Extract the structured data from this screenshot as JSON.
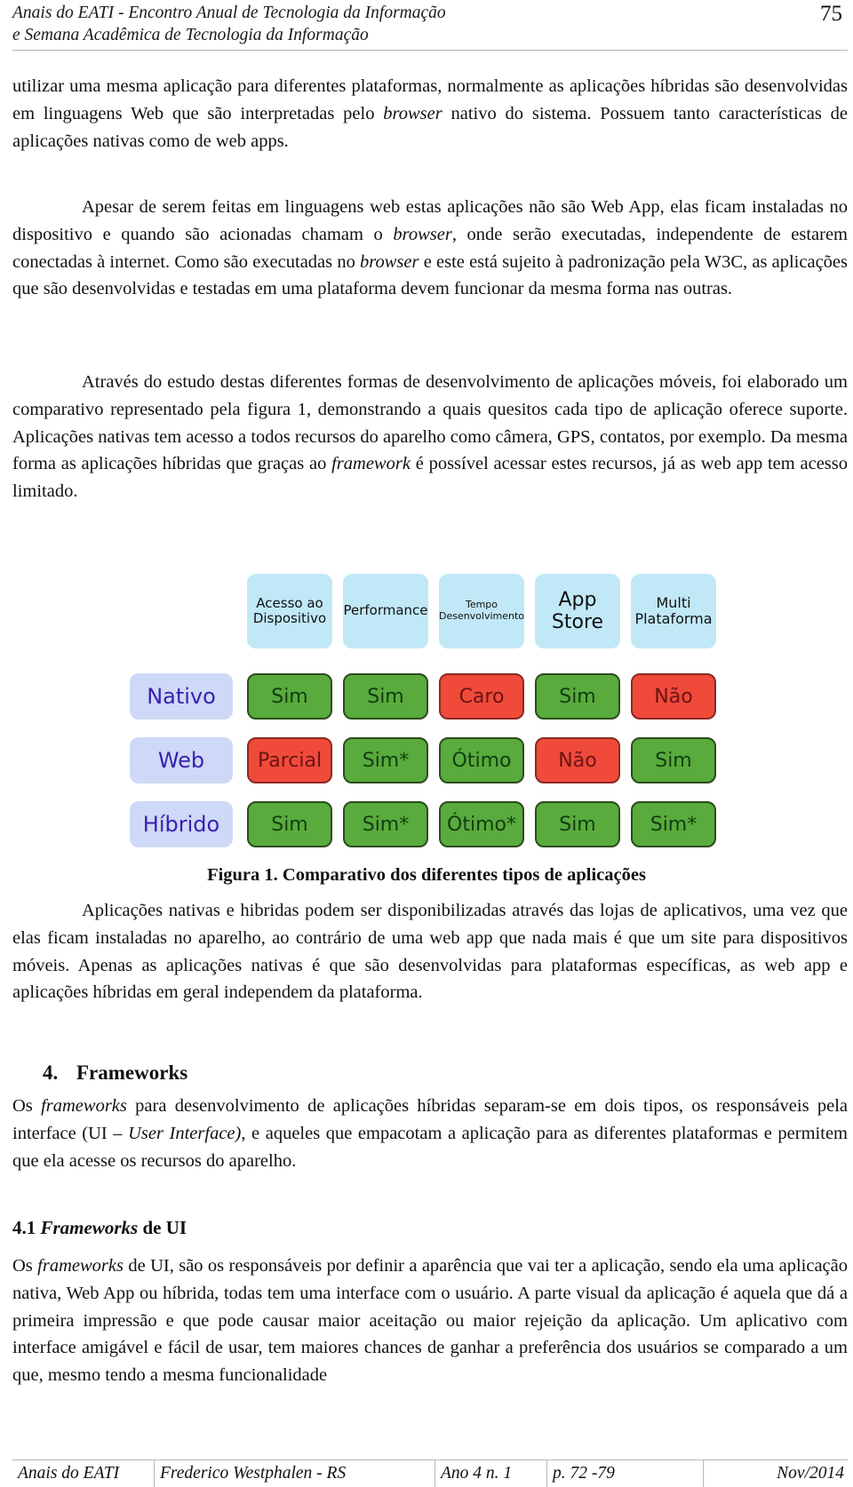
{
  "header": {
    "line1": "Anais do EATI - Encontro Anual de Tecnologia da Informação",
    "line2": "e Semana Acadêmica de Tecnologia da Informação",
    "page_number": "75"
  },
  "paragraphs": {
    "p1": [
      "utilizar uma mesma aplicação para diferentes plataformas, normalmente as aplicações híbridas são desenvolvidas em linguagens Web que são interpretadas pelo ",
      "browser",
      " nativo do sistema. Possuem tanto características de aplicações nativas como de web apps."
    ],
    "p2": [
      "Apesar de serem feitas em linguagens web estas aplicações não são Web App, elas ficam instaladas no dispositivo e quando são acionadas chamam o ",
      "browser",
      ", onde serão executadas, independente de estarem conectadas à internet. Como são executadas no ",
      "browser",
      " e este está sujeito à padronização pela W3C, as aplicações que são desenvolvidas e testadas em uma plataforma devem funcionar da mesma forma nas outras."
    ],
    "p3": [
      "Através do estudo destas diferentes formas de desenvolvimento de aplicações móveis, foi elaborado um comparativo representado pela figura 1, demonstrando a quais quesitos cada tipo de aplicação oferece suporte. Aplicações nativas tem acesso a todos recursos do aparelho como câmera, GPS, contatos, por exemplo. Da mesma forma as aplicações híbridas que graças ao ",
      "framework",
      " é possível acessar estes recursos, já as web app tem acesso limitado."
    ],
    "p4": "Aplicações nativas e hibridas podem ser disponibilizadas através das lojas de aplicativos, uma vez que elas ficam instaladas no aparelho, ao contrário de uma web app que nada mais é que um site para dispositivos móveis. Apenas as aplicações nativas é que são desenvolvidas para plataformas específicas, as web app e aplicações híbridas em geral independem da plataforma.",
    "p5": [
      "Os ",
      "frameworks",
      " para desenvolvimento de aplicações híbridas separam-se em dois tipos, os responsáveis pela interface (UI – ",
      "User Interface)",
      ", e aqueles que empacotam a aplicação para as diferentes plataformas e permitem que ela acesse os recursos do aparelho."
    ],
    "p6": [
      "Os ",
      "frameworks",
      " de UI, são os responsáveis por definir a aparência que vai ter a aplicação, sendo ela uma aplicação nativa, Web App ou híbrida, todas tem uma interface com o usuário. A parte visual da aplicação é aquela que dá a primeira impressão e que pode causar maior aceitação ou maior rejeição da aplicação. Um aplicativo com interface amigável e fácil de usar, tem maiores chances de ganhar a preferência dos usuários se comparado a um que, mesmo tendo a mesma funcionalidade"
    ]
  },
  "figure": {
    "columns": [
      "Acesso ao Dispositivo",
      "Performance",
      "Tempo Desenvolvimento",
      "App Store",
      "Multi Plataforma"
    ],
    "rows": [
      {
        "label": "Nativo",
        "cells": [
          {
            "text": "Sim",
            "status": "good"
          },
          {
            "text": "Sim",
            "status": "good"
          },
          {
            "text": "Caro",
            "status": "bad"
          },
          {
            "text": "Sim",
            "status": "good"
          },
          {
            "text": "Não",
            "status": "bad"
          }
        ]
      },
      {
        "label": "Web",
        "cells": [
          {
            "text": "Parcial",
            "status": "bad"
          },
          {
            "text": "Sim*",
            "status": "good"
          },
          {
            "text": "Ótimo",
            "status": "good"
          },
          {
            "text": "Não",
            "status": "bad"
          },
          {
            "text": "Sim",
            "status": "good"
          }
        ]
      },
      {
        "label": "Híbrido",
        "cells": [
          {
            "text": "Sim",
            "status": "good"
          },
          {
            "text": "Sim*",
            "status": "good"
          },
          {
            "text": "Ótimo*",
            "status": "good"
          },
          {
            "text": "Sim",
            "status": "good"
          },
          {
            "text": "Sim*",
            "status": "good"
          }
        ]
      }
    ],
    "colors": {
      "good": "#58ab3c",
      "bad": "#f04a3a",
      "header": "#c1e8f7",
      "row_label": "#cdd9f6"
    },
    "caption": "Figura 1. Comparativo dos diferentes tipos de aplicações"
  },
  "sections": {
    "s4": {
      "number": "4.",
      "title": "Frameworks"
    },
    "s41": {
      "number": "4.1 ",
      "title_italic": "Frameworks",
      "title_rest": " de UI"
    }
  },
  "footer": {
    "journal": "Anais do EATI",
    "location": "Frederico Westphalen - RS",
    "issue": "Ano 4 n. 1",
    "pages": "p. 72 -79",
    "date": "Nov/2014"
  }
}
